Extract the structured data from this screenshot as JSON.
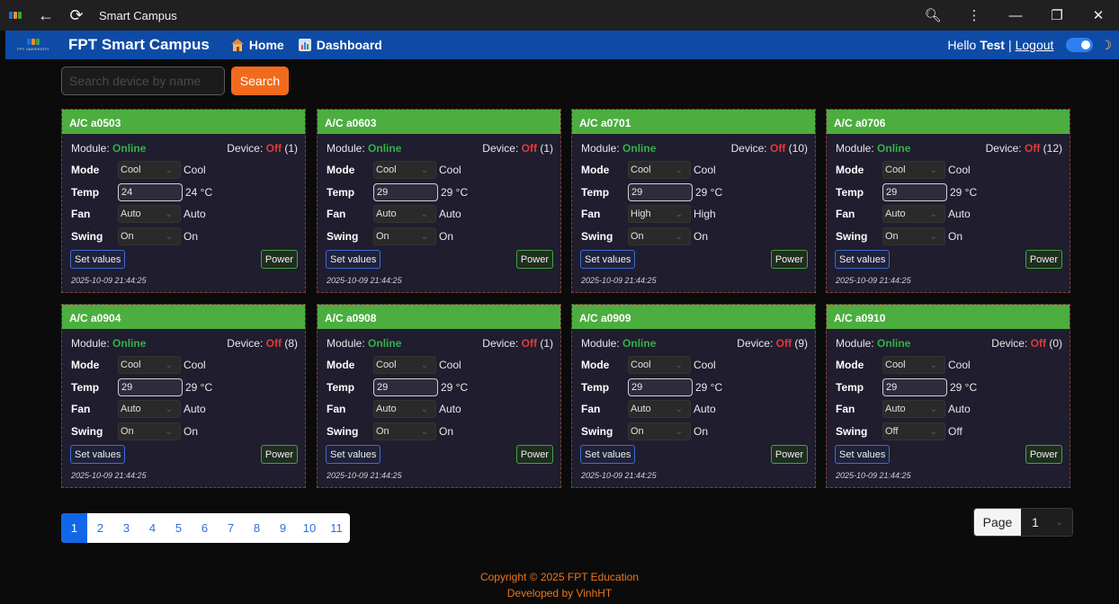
{
  "titlebar": {
    "title": "Smart Campus"
  },
  "navbar": {
    "brand": "FPT Smart Campus",
    "brand_logo_caption": "FPT UNIVERSITY",
    "home_label": "Home",
    "dashboard_label": "Dashboard",
    "hello_prefix": "Hello",
    "username": "Test",
    "separator": "|",
    "logout_label": "Logout",
    "moon_glyph": "☽"
  },
  "search": {
    "placeholder": "Search device by name",
    "button_label": "Search"
  },
  "labels": {
    "module": "Module:",
    "device": "Device:",
    "mode": "Mode",
    "temp": "Temp",
    "fan": "Fan",
    "swing": "Swing",
    "set_values": "Set values",
    "power": "Power"
  },
  "cards": [
    {
      "name": "A/C a0503",
      "module_status": "Online",
      "device_status": "Off",
      "device_count": "(1)",
      "mode": "Cool",
      "mode_value": "Cool",
      "temp_input": "24",
      "temp_value": "24 °C",
      "fan": "Auto",
      "fan_value": "Auto",
      "swing": "On",
      "swing_value": "On",
      "timestamp": "2025-10-09 21:44:25"
    },
    {
      "name": "A/C a0603",
      "module_status": "Online",
      "device_status": "Off",
      "device_count": "(1)",
      "mode": "Cool",
      "mode_value": "Cool",
      "temp_input": "29",
      "temp_value": "29 °C",
      "fan": "Auto",
      "fan_value": "Auto",
      "swing": "On",
      "swing_value": "On",
      "timestamp": "2025-10-09 21:44:25"
    },
    {
      "name": "A/C a0701",
      "module_status": "Online",
      "device_status": "Off",
      "device_count": "(10)",
      "mode": "Cool",
      "mode_value": "Cool",
      "temp_input": "29",
      "temp_value": "29 °C",
      "fan": "High",
      "fan_value": "High",
      "swing": "On",
      "swing_value": "On",
      "timestamp": "2025-10-09 21:44:25"
    },
    {
      "name": "A/C a0706",
      "module_status": "Online",
      "device_status": "Off",
      "device_count": "(12)",
      "mode": "Cool",
      "mode_value": "Cool",
      "temp_input": "29",
      "temp_value": "29 °C",
      "fan": "Auto",
      "fan_value": "Auto",
      "swing": "On",
      "swing_value": "On",
      "timestamp": "2025-10-09 21:44:25"
    },
    {
      "name": "A/C a0904",
      "module_status": "Online",
      "device_status": "Off",
      "device_count": "(8)",
      "mode": "Cool",
      "mode_value": "Cool",
      "temp_input": "29",
      "temp_value": "29 °C",
      "fan": "Auto",
      "fan_value": "Auto",
      "swing": "On",
      "swing_value": "On",
      "timestamp": "2025-10-09 21:44:25"
    },
    {
      "name": "A/C a0908",
      "module_status": "Online",
      "device_status": "Off",
      "device_count": "(1)",
      "mode": "Cool",
      "mode_value": "Cool",
      "temp_input": "29",
      "temp_value": "29 °C",
      "fan": "Auto",
      "fan_value": "Auto",
      "swing": "On",
      "swing_value": "On",
      "timestamp": "2025-10-09 21:44:25"
    },
    {
      "name": "A/C a0909",
      "module_status": "Online",
      "device_status": "Off",
      "device_count": "(9)",
      "mode": "Cool",
      "mode_value": "Cool",
      "temp_input": "29",
      "temp_value": "29 °C",
      "fan": "Auto",
      "fan_value": "Auto",
      "swing": "On",
      "swing_value": "On",
      "timestamp": "2025-10-09 21:44:25"
    },
    {
      "name": "A/C a0910",
      "module_status": "Online",
      "device_status": "Off",
      "device_count": "(0)",
      "mode": "Cool",
      "mode_value": "Cool",
      "temp_input": "29",
      "temp_value": "29 °C",
      "fan": "Auto",
      "fan_value": "Auto",
      "swing": "Off",
      "swing_value": "Off",
      "timestamp": "2025-10-09 21:44:25"
    }
  ],
  "pagination": {
    "pages": [
      "1",
      "2",
      "3",
      "4",
      "5",
      "6",
      "7",
      "8",
      "9",
      "10",
      "11"
    ],
    "active": "1"
  },
  "page_selector": {
    "label": "Page",
    "value": "1"
  },
  "footer": {
    "copyright": "Copyright © 2025 FPT Education",
    "developer": "Developed by VinhHT"
  },
  "colors": {
    "navbar": "#0e4ba6",
    "card_header": "#4cae3f",
    "online": "#33b249",
    "off": "#e23a3a",
    "accent": "#f26b1d"
  }
}
